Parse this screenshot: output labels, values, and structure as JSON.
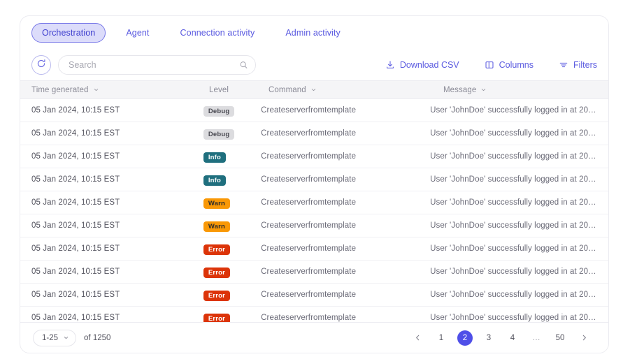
{
  "tabs": [
    {
      "label": "Orchestration",
      "active": true
    },
    {
      "label": "Agent",
      "active": false
    },
    {
      "label": "Connection activity",
      "active": false
    },
    {
      "label": "Admin activity",
      "active": false
    }
  ],
  "toolbar": {
    "refresh_icon": "refresh-icon",
    "search": {
      "value": "",
      "placeholder": "Search",
      "icon": "search-icon"
    },
    "actions": [
      {
        "label": "Download CSV",
        "icon": "download-icon"
      },
      {
        "label": "Columns",
        "icon": "columns-icon"
      },
      {
        "label": "Filters",
        "icon": "filters-icon"
      }
    ]
  },
  "table": {
    "columns": [
      {
        "label": "Time generated",
        "sortable": true
      },
      {
        "label": "Level",
        "sortable": false
      },
      {
        "label": "Command",
        "sortable": true
      },
      {
        "label": "Message",
        "sortable": true
      }
    ],
    "rows": [
      {
        "time": "05 Jan 2024, 10:15 EST",
        "level": "Debug",
        "level_key": "debug",
        "command": "Createserverfromtemplate",
        "message": "User 'JohnDoe' successfully logged in at 2024..."
      },
      {
        "time": "05 Jan 2024, 10:15 EST",
        "level": "Debug",
        "level_key": "debug",
        "command": "Createserverfromtemplate",
        "message": "User 'JohnDoe' successfully logged in at 2024..."
      },
      {
        "time": "05 Jan 2024, 10:15 EST",
        "level": "Info",
        "level_key": "info",
        "command": "Createserverfromtemplate",
        "message": "User 'JohnDoe' successfully logged in at 2024..."
      },
      {
        "time": "05 Jan 2024, 10:15 EST",
        "level": "Info",
        "level_key": "info",
        "command": "Createserverfromtemplate",
        "message": "User 'JohnDoe' successfully logged in at 2024..."
      },
      {
        "time": "05 Jan 2024, 10:15 EST",
        "level": "Warn",
        "level_key": "warn",
        "command": "Createserverfromtemplate",
        "message": "User 'JohnDoe' successfully logged in at 2024..."
      },
      {
        "time": "05 Jan 2024, 10:15 EST",
        "level": "Warn",
        "level_key": "warn",
        "command": "Createserverfromtemplate",
        "message": "User 'JohnDoe' successfully logged in at 2024..."
      },
      {
        "time": "05 Jan 2024, 10:15 EST",
        "level": "Error",
        "level_key": "error",
        "command": "Createserverfromtemplate",
        "message": "User 'JohnDoe' successfully logged in at 2024..."
      },
      {
        "time": "05 Jan 2024, 10:15 EST",
        "level": "Error",
        "level_key": "error",
        "command": "Createserverfromtemplate",
        "message": "User 'JohnDoe' successfully logged in at 2024..."
      },
      {
        "time": "05 Jan 2024, 10:15 EST",
        "level": "Error",
        "level_key": "error",
        "command": "Createserverfromtemplate",
        "message": "User 'JohnDoe' successfully logged in at 2024..."
      },
      {
        "time": "05 Jan 2024, 10:15 EST",
        "level": "Error",
        "level_key": "error",
        "command": "Createserverfromtemplate",
        "message": "User 'JohnDoe' successfully logged in at 2024..."
      }
    ]
  },
  "footer": {
    "page_size_label": "1-25",
    "total_label": "of 1250",
    "prev_icon": "chevron-left-icon",
    "next_icon": "chevron-right-icon",
    "pages": [
      {
        "label": "1",
        "active": false,
        "ellipsis": false
      },
      {
        "label": "2",
        "active": true,
        "ellipsis": false
      },
      {
        "label": "3",
        "active": false,
        "ellipsis": false
      },
      {
        "label": "4",
        "active": false,
        "ellipsis": false
      },
      {
        "label": "…",
        "active": false,
        "ellipsis": true
      },
      {
        "label": "50",
        "active": false,
        "ellipsis": false
      }
    ]
  },
  "colors": {
    "accent": "#5a5ae0",
    "active_page": "#4f4fe8",
    "tab_active_bg": "#dcdcfa",
    "badge_debug": "#dcdcdf",
    "badge_info": "#1f6f7e",
    "badge_warn": "#f99806",
    "badge_error": "#dc3409",
    "header_bg": "#f5f5f7"
  }
}
